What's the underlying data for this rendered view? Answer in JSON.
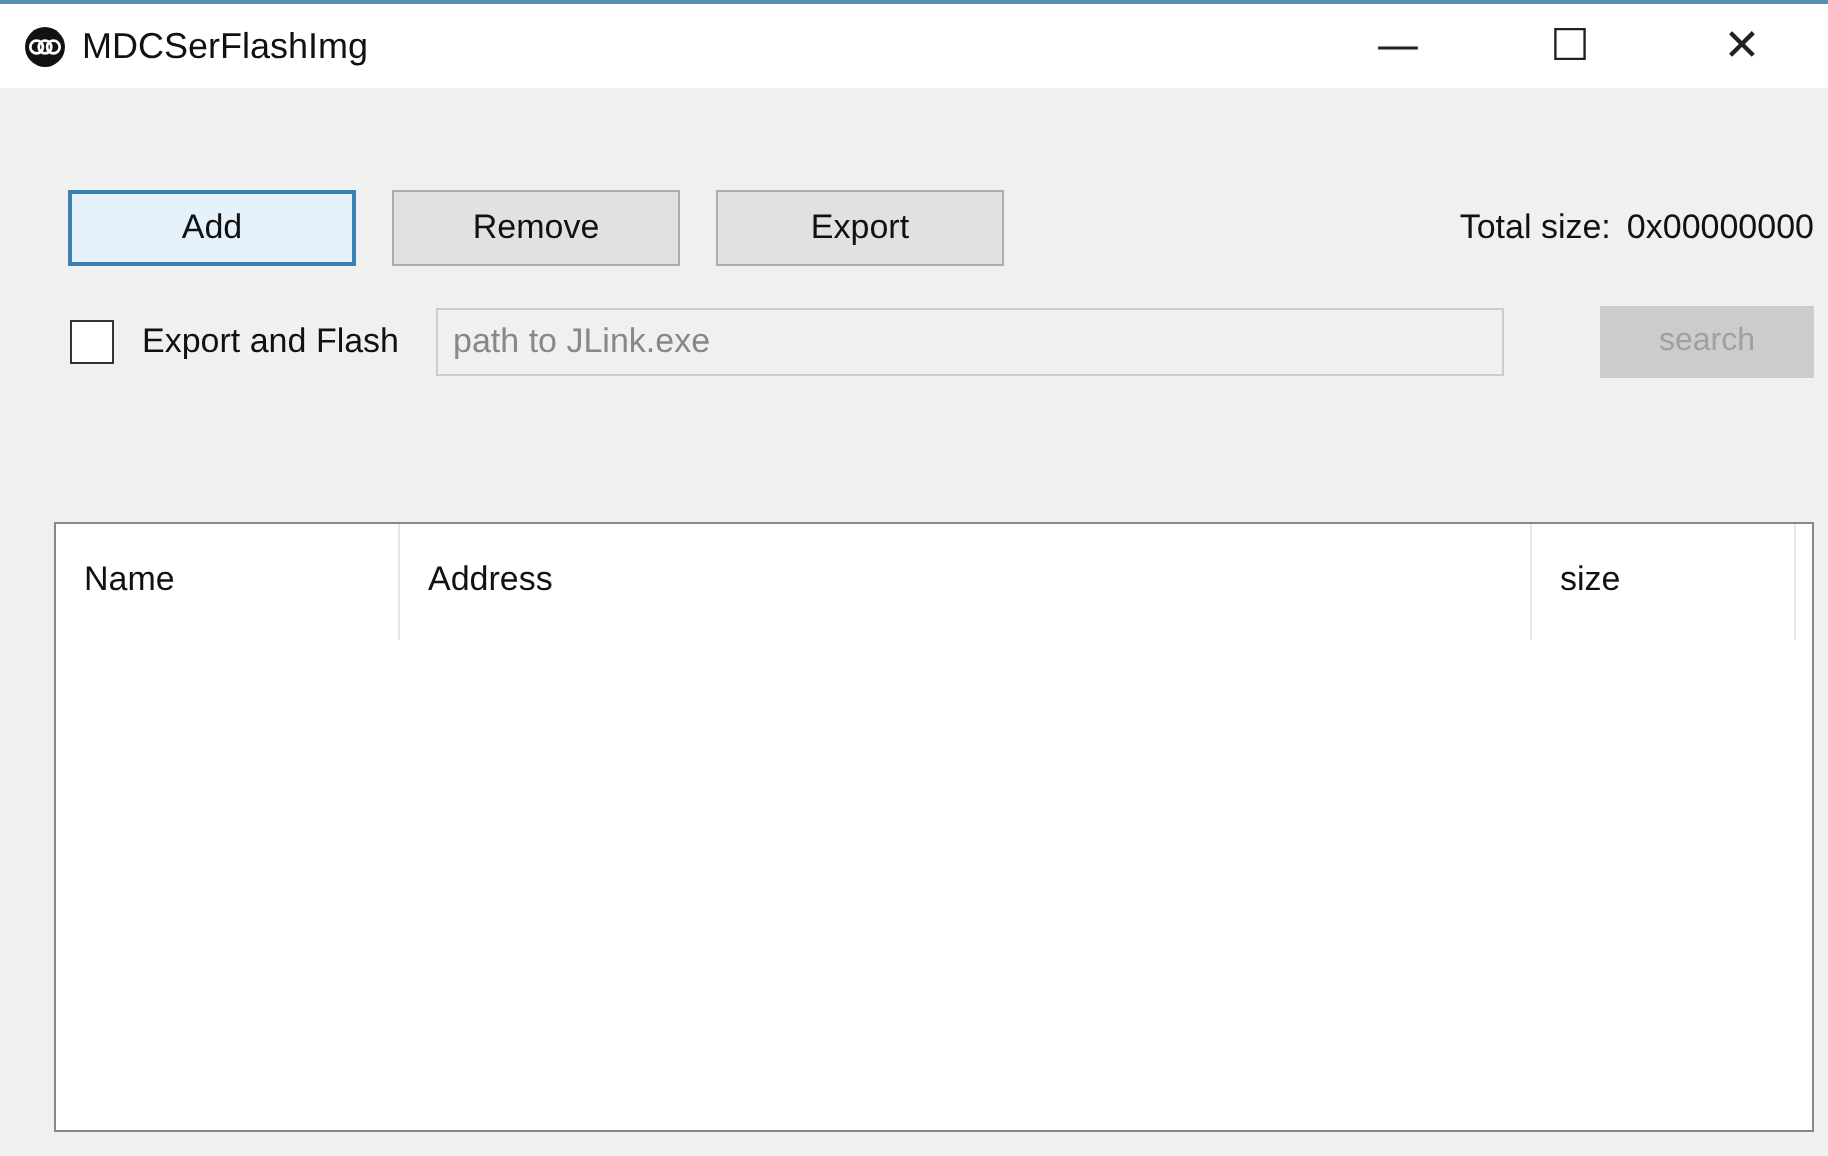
{
  "window": {
    "title": "MDCSerFlashImg",
    "controls": [
      "—",
      "☐",
      "✕"
    ]
  },
  "buttons": [
    {
      "label": "Add",
      "focused": true
    },
    {
      "label": "Remove",
      "focused": false
    },
    {
      "label": "Export",
      "focused": false
    }
  ],
  "total_size": {
    "label": "Total size:",
    "value": "0x00000000"
  },
  "export_and_flash": {
    "label": "Export and Flash",
    "checked": false
  },
  "path_field": {
    "placeholder": "path to JLink.exe"
  },
  "search_button": {
    "label": "search",
    "disabled": true
  },
  "table": {
    "columns": [
      "Name",
      "Address",
      "size"
    ]
  }
}
